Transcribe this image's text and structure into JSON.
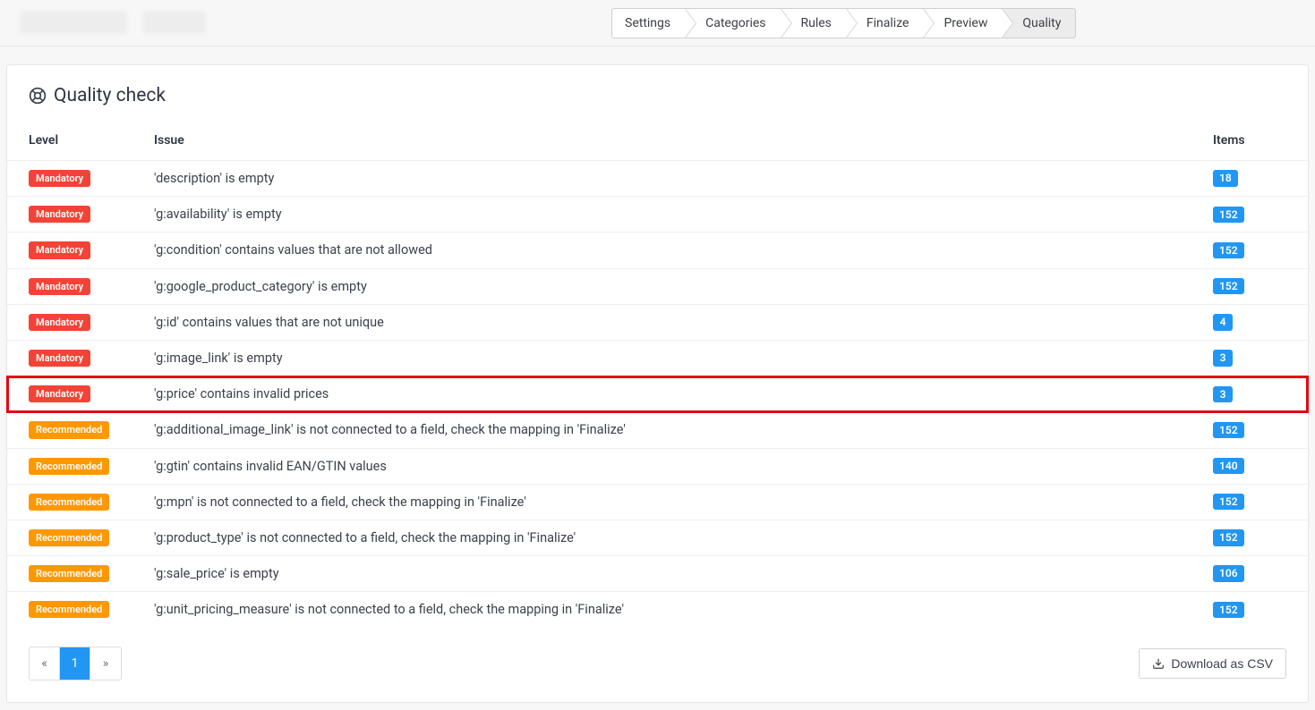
{
  "steps": {
    "items": [
      {
        "label": "Settings",
        "active": false
      },
      {
        "label": "Categories",
        "active": false
      },
      {
        "label": "Rules",
        "active": false
      },
      {
        "label": "Finalize",
        "active": false
      },
      {
        "label": "Preview",
        "active": false
      },
      {
        "label": "Quality",
        "active": true
      }
    ]
  },
  "panel": {
    "title": "Quality check"
  },
  "table": {
    "headers": {
      "level": "Level",
      "issue": "Issue",
      "items": "Items"
    },
    "rows": [
      {
        "level": "Mandatory",
        "level_kind": "mandatory",
        "issue": "'description' is empty",
        "items": "18",
        "highlight": false
      },
      {
        "level": "Mandatory",
        "level_kind": "mandatory",
        "issue": "'g:availability' is empty",
        "items": "152",
        "highlight": false
      },
      {
        "level": "Mandatory",
        "level_kind": "mandatory",
        "issue": "'g:condition' contains values that are not allowed",
        "items": "152",
        "highlight": false
      },
      {
        "level": "Mandatory",
        "level_kind": "mandatory",
        "issue": "'g:google_product_category' is empty",
        "items": "152",
        "highlight": false
      },
      {
        "level": "Mandatory",
        "level_kind": "mandatory",
        "issue": "'g:id' contains values that are not unique",
        "items": "4",
        "highlight": false
      },
      {
        "level": "Mandatory",
        "level_kind": "mandatory",
        "issue": "'g:image_link' is empty",
        "items": "3",
        "highlight": false
      },
      {
        "level": "Mandatory",
        "level_kind": "mandatory",
        "issue": "'g:price' contains invalid prices",
        "items": "3",
        "highlight": true
      },
      {
        "level": "Recommended",
        "level_kind": "recommended",
        "issue": "'g:additional_image_link' is not connected to a field, check the mapping in 'Finalize'",
        "items": "152",
        "highlight": false
      },
      {
        "level": "Recommended",
        "level_kind": "recommended",
        "issue": "'g:gtin' contains invalid EAN/GTIN values",
        "items": "140",
        "highlight": false
      },
      {
        "level": "Recommended",
        "level_kind": "recommended",
        "issue": "'g:mpn' is not connected to a field, check the mapping in 'Finalize'",
        "items": "152",
        "highlight": false
      },
      {
        "level": "Recommended",
        "level_kind": "recommended",
        "issue": "'g:product_type' is not connected to a field, check the mapping in 'Finalize'",
        "items": "152",
        "highlight": false
      },
      {
        "level": "Recommended",
        "level_kind": "recommended",
        "issue": "'g:sale_price' is empty",
        "items": "106",
        "highlight": false
      },
      {
        "level": "Recommended",
        "level_kind": "recommended",
        "issue": "'g:unit_pricing_measure' is not connected to a field, check the mapping in 'Finalize'",
        "items": "152",
        "highlight": false
      }
    ]
  },
  "pager": {
    "prev": "«",
    "page": "1",
    "next": "»"
  },
  "actions": {
    "download_csv": "Download as CSV"
  }
}
